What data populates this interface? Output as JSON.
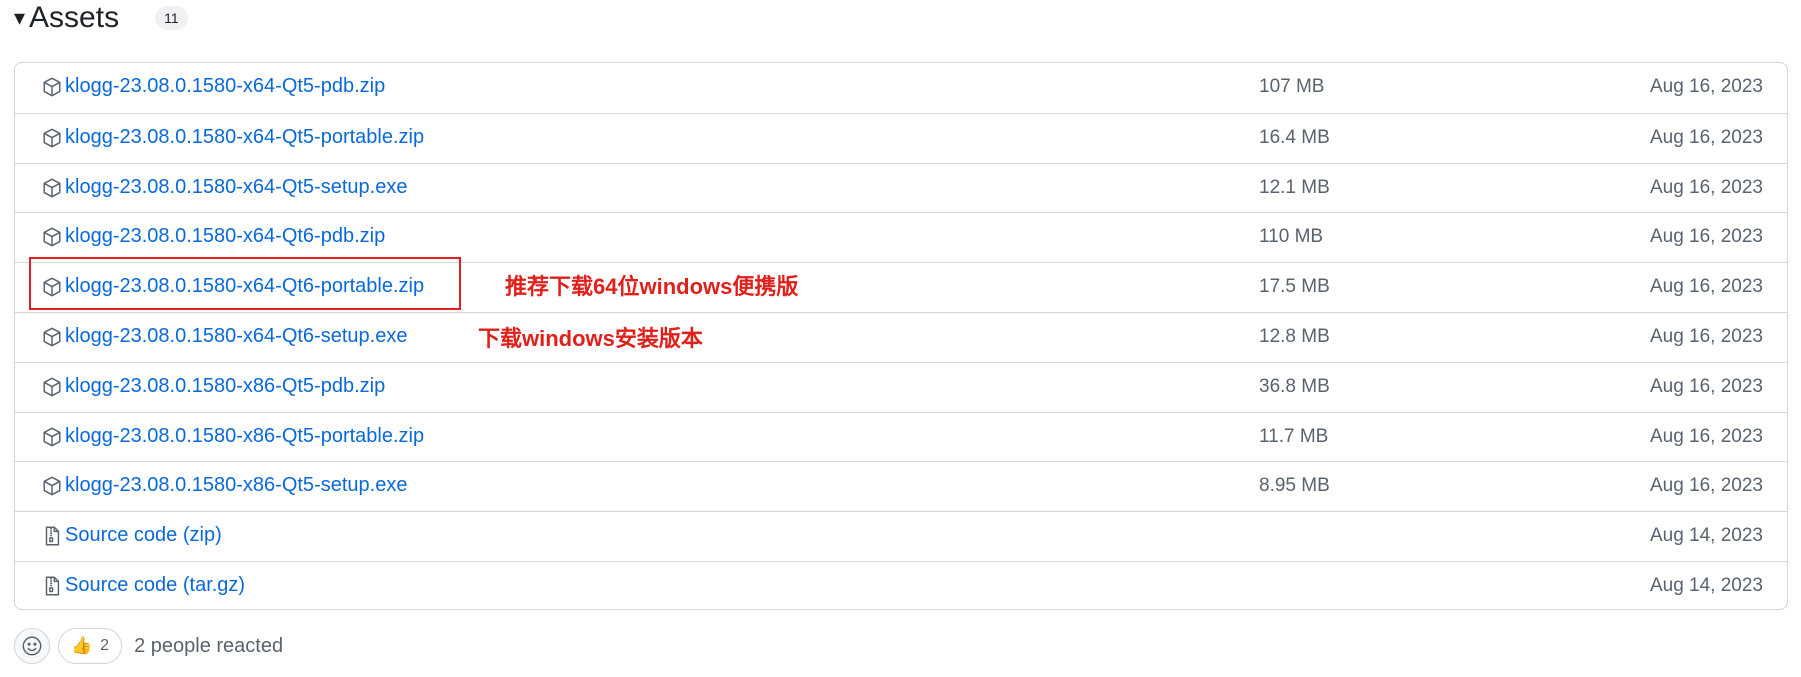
{
  "assets": {
    "caret": "▾",
    "title": "Assets",
    "count": "11",
    "rows": [
      {
        "icon": "package-icon",
        "name": "klogg-23.08.0.1580-x64-Qt5-pdb.zip",
        "suffix": "",
        "size": "107 MB",
        "date": "Aug 16, 2023"
      },
      {
        "icon": "package-icon",
        "name": "klogg-23.08.0.1580-x64-Qt5-portable.zip",
        "suffix": "",
        "size": "16.4 MB",
        "date": "Aug 16, 2023"
      },
      {
        "icon": "package-icon",
        "name": "klogg-23.08.0.1580-x64-Qt5-setup.exe",
        "suffix": "",
        "size": "12.1 MB",
        "date": "Aug 16, 2023"
      },
      {
        "icon": "package-icon",
        "name": "klogg-23.08.0.1580-x64-Qt6-pdb.zip",
        "suffix": "",
        "size": "110 MB",
        "date": "Aug 16, 2023"
      },
      {
        "icon": "package-icon",
        "name": "klogg-23.08.0.1580-x64-Qt6-portable.zip",
        "suffix": "",
        "size": "17.5 MB",
        "date": "Aug 16, 2023"
      },
      {
        "icon": "package-icon",
        "name": "klogg-23.08.0.1580-x64-Qt6-setup.exe",
        "suffix": "",
        "size": "12.8 MB",
        "date": "Aug 16, 2023"
      },
      {
        "icon": "package-icon",
        "name": "klogg-23.08.0.1580-x86-Qt5-pdb.zip",
        "suffix": "",
        "size": "36.8 MB",
        "date": "Aug 16, 2023"
      },
      {
        "icon": "package-icon",
        "name": "klogg-23.08.0.1580-x86-Qt5-portable.zip",
        "suffix": "",
        "size": "11.7 MB",
        "date": "Aug 16, 2023"
      },
      {
        "icon": "package-icon",
        "name": "klogg-23.08.0.1580-x86-Qt5-setup.exe",
        "suffix": "",
        "size": "8.95 MB",
        "date": "Aug 16, 2023"
      },
      {
        "icon": "file-zip-icon",
        "name": "Source code",
        "suffix": " (zip)",
        "size": "",
        "date": "Aug 14, 2023"
      },
      {
        "icon": "file-zip-icon",
        "name": "Source code",
        "suffix": " (tar.gz)",
        "size": "",
        "date": "Aug 14, 2023"
      }
    ]
  },
  "annotations": {
    "recommend_portable": "推荐下载64位windows便携版",
    "download_setup": "下载windows安装版本",
    "highlight_color": "#e02020"
  },
  "reactions": {
    "thumbs_emoji": "👍",
    "thumbs_count": "2",
    "summary": "2 people reacted"
  },
  "colors": {
    "link": "#0969da",
    "muted": "#59636e",
    "border": "#d0d7de"
  }
}
